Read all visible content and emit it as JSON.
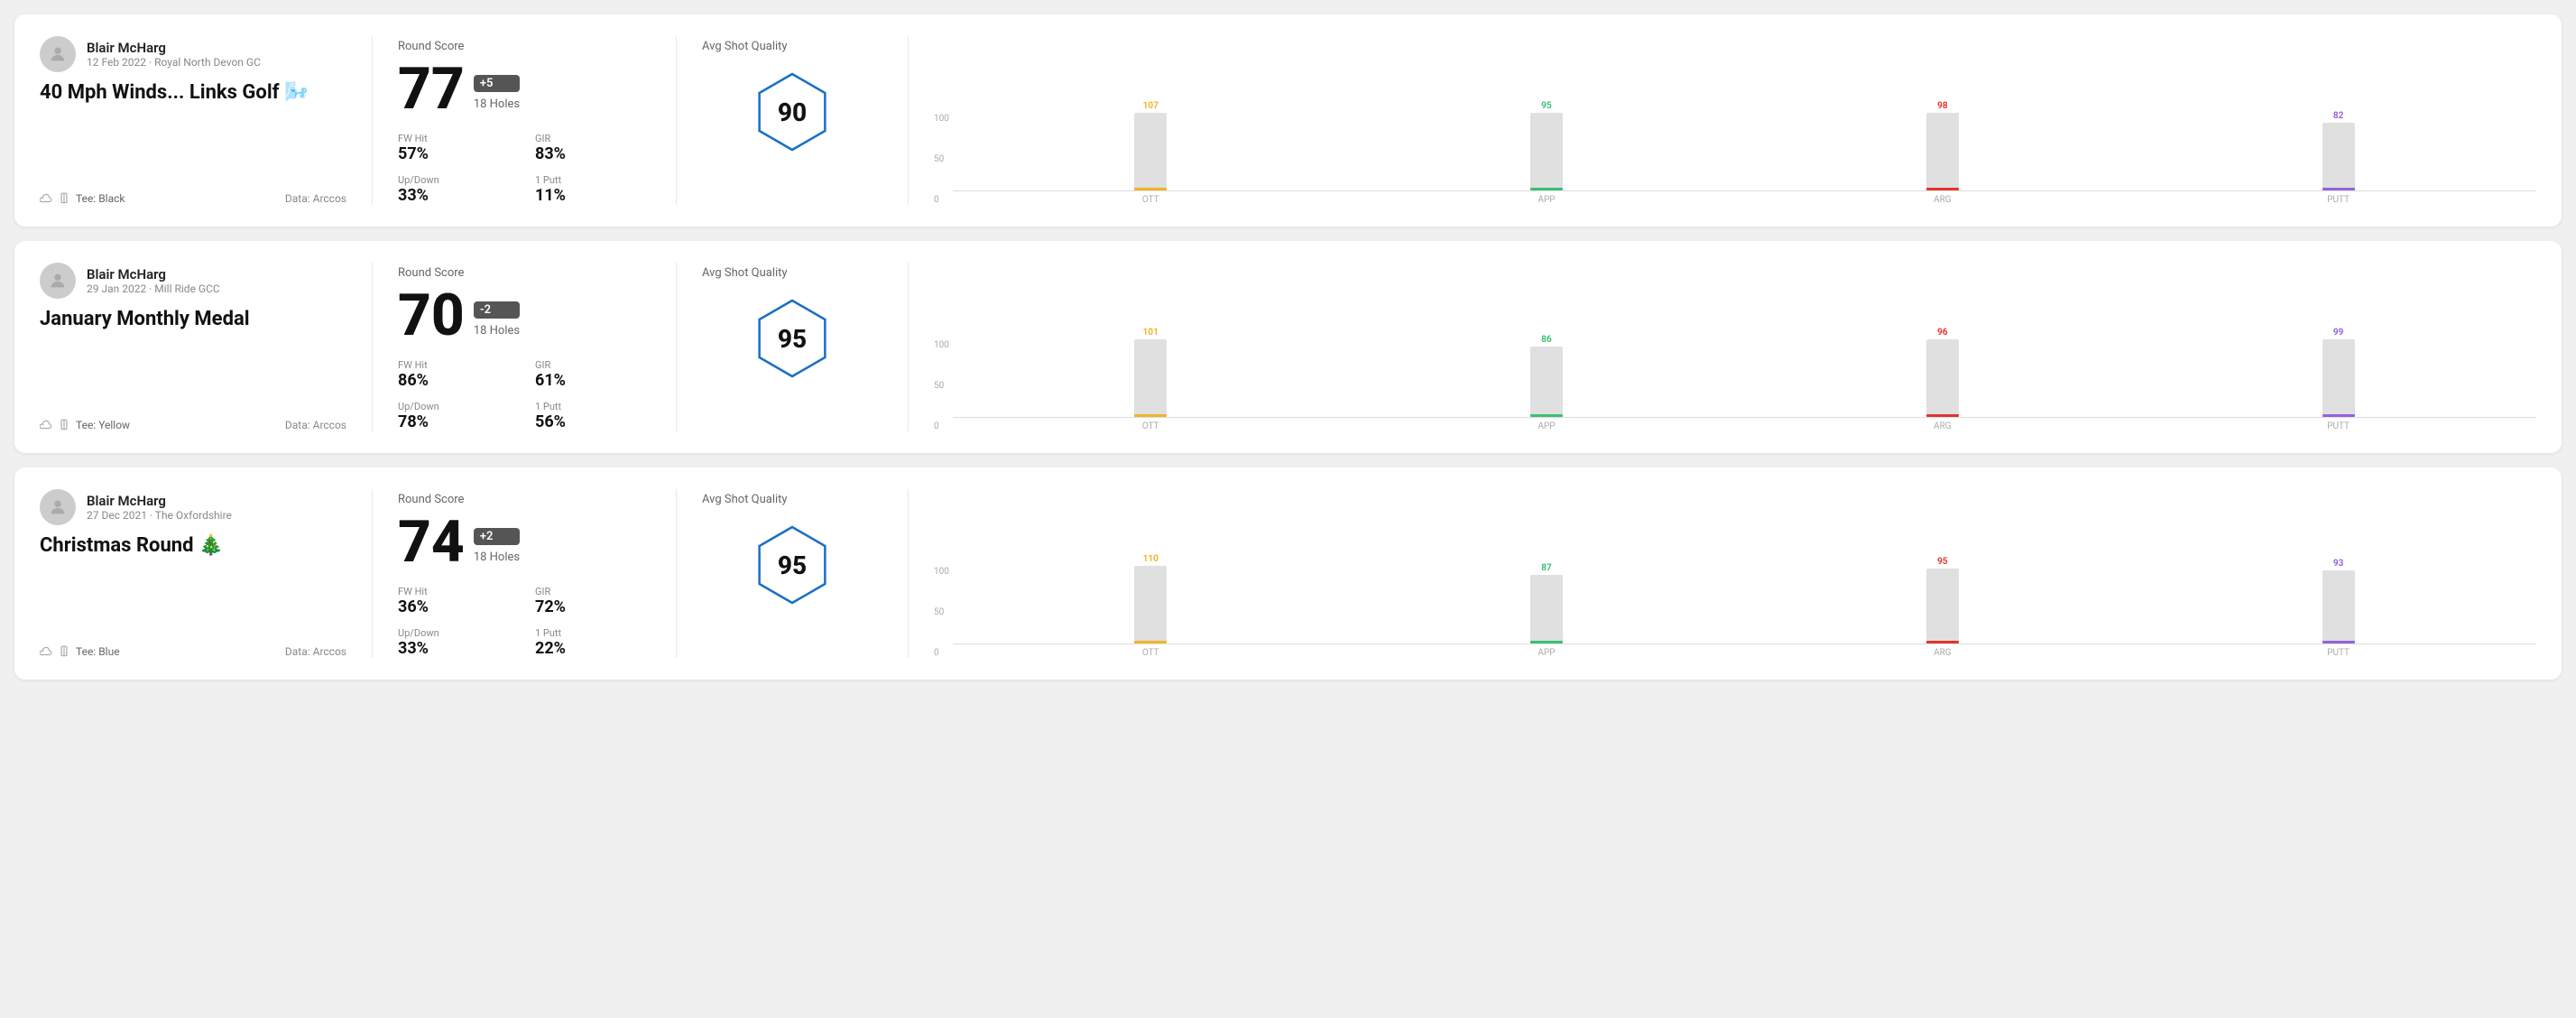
{
  "rounds": [
    {
      "id": "round1",
      "user": {
        "name": "Blair McHarg",
        "date_course": "12 Feb 2022 · Royal North Devon GC"
      },
      "title": "40 Mph Winds... Links Golf 🌬️",
      "tee": "Black",
      "data_source": "Data: Arccos",
      "score": "77",
      "score_badge": "+5",
      "holes": "18 Holes",
      "fw_hit": "57%",
      "gir": "83%",
      "up_down": "33%",
      "one_putt": "11%",
      "avg_shot_quality_label": "Avg Shot Quality",
      "quality_score": "90",
      "chart": {
        "bars": [
          {
            "label": "OTT",
            "value": 107,
            "color": "#f0b429"
          },
          {
            "label": "APP",
            "value": 95,
            "color": "#38c172"
          },
          {
            "label": "ARG",
            "value": 98,
            "color": "#e3342f"
          },
          {
            "label": "PUTT",
            "value": 82,
            "color": "#9561e2"
          }
        ],
        "max": 110,
        "y_labels": [
          "100",
          "50",
          "0"
        ]
      }
    },
    {
      "id": "round2",
      "user": {
        "name": "Blair McHarg",
        "date_course": "29 Jan 2022 · Mill Ride GCC"
      },
      "title": "January Monthly Medal",
      "tee": "Yellow",
      "data_source": "Data: Arccos",
      "score": "70",
      "score_badge": "-2",
      "holes": "18 Holes",
      "fw_hit": "86%",
      "gir": "61%",
      "up_down": "78%",
      "one_putt": "56%",
      "avg_shot_quality_label": "Avg Shot Quality",
      "quality_score": "95",
      "chart": {
        "bars": [
          {
            "label": "OTT",
            "value": 101,
            "color": "#f0b429"
          },
          {
            "label": "APP",
            "value": 86,
            "color": "#38c172"
          },
          {
            "label": "ARG",
            "value": 96,
            "color": "#e3342f"
          },
          {
            "label": "PUTT",
            "value": 99,
            "color": "#9561e2"
          }
        ],
        "max": 110,
        "y_labels": [
          "100",
          "50",
          "0"
        ]
      }
    },
    {
      "id": "round3",
      "user": {
        "name": "Blair McHarg",
        "date_course": "27 Dec 2021 · The Oxfordshire"
      },
      "title": "Christmas Round 🎄",
      "tee": "Blue",
      "data_source": "Data: Arccos",
      "score": "74",
      "score_badge": "+2",
      "holes": "18 Holes",
      "fw_hit": "36%",
      "gir": "72%",
      "up_down": "33%",
      "one_putt": "22%",
      "avg_shot_quality_label": "Avg Shot Quality",
      "quality_score": "95",
      "chart": {
        "bars": [
          {
            "label": "OTT",
            "value": 110,
            "color": "#f0b429"
          },
          {
            "label": "APP",
            "value": 87,
            "color": "#38c172"
          },
          {
            "label": "ARG",
            "value": 95,
            "color": "#e3342f"
          },
          {
            "label": "PUTT",
            "value": 93,
            "color": "#9561e2"
          }
        ],
        "max": 115,
        "y_labels": [
          "100",
          "50",
          "0"
        ]
      }
    }
  ],
  "labels": {
    "round_score": "Round Score",
    "fw_hit": "FW Hit",
    "gir": "GIR",
    "up_down": "Up/Down",
    "one_putt": "1 Putt",
    "avg_shot_quality": "Avg Shot Quality",
    "tee_prefix": "Tee:",
    "data_arccos": "Data: Arccos"
  }
}
